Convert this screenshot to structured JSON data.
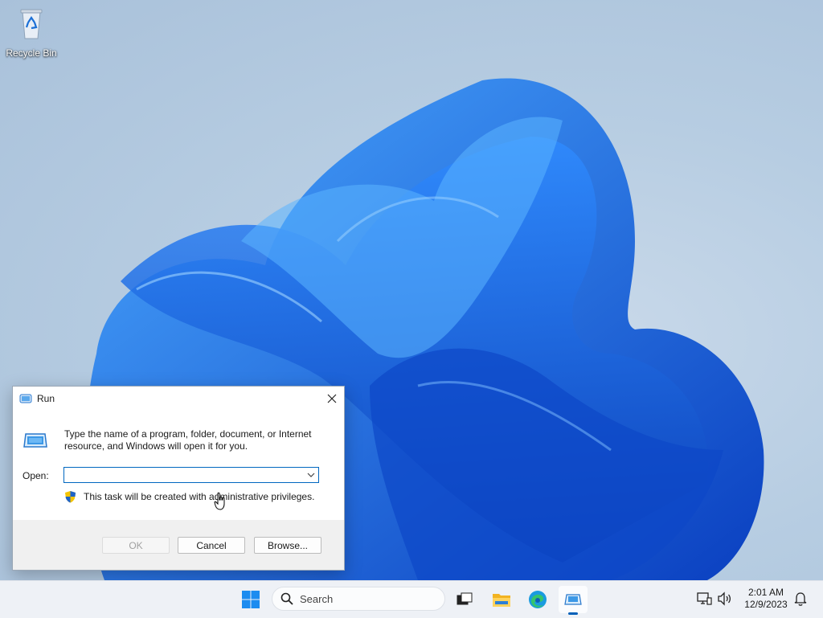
{
  "desktop": {
    "icons": [
      {
        "label": "Recycle Bin",
        "icon": "recycle-bin-icon"
      }
    ]
  },
  "run_dialog": {
    "title": "Run",
    "description": "Type the name of a program, folder, document, or Internet resource, and Windows will open it for you.",
    "open_label": "Open:",
    "open_value": "",
    "admin_note": "This task will be created with administrative privileges.",
    "buttons": {
      "ok": "OK",
      "cancel": "Cancel",
      "browse": "Browse..."
    }
  },
  "taskbar": {
    "search_placeholder": "Search",
    "apps": [
      "start-icon",
      "task-view-icon",
      "file-explorer-icon",
      "edge-icon",
      "run-app-icon"
    ],
    "clock": {
      "time": "2:01 AM",
      "date": "12/9/2023"
    }
  },
  "colors": {
    "accent": "#0067c0",
    "bloom": "#1e6fe0",
    "taskbar": "#eef1f6"
  }
}
